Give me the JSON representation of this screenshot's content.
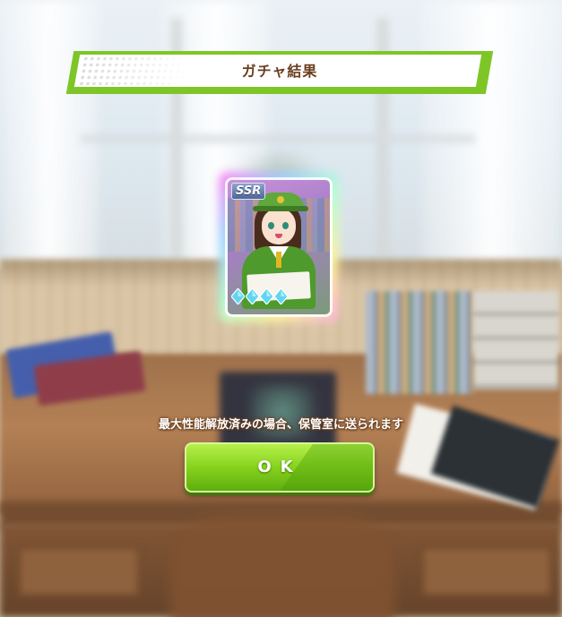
{
  "banner": {
    "title": "ガチャ結果"
  },
  "card": {
    "rarity": "SSR",
    "gem_count": 4,
    "gem_color": "#5fd6f2"
  },
  "notice": {
    "text": "最大性能解放済みの場合、保管室に送られます"
  },
  "ok_button": {
    "label": "OK"
  },
  "colors": {
    "accent_green": "#7ec627",
    "title_brown": "#6a3e1f",
    "button_green": "#86d21e"
  }
}
